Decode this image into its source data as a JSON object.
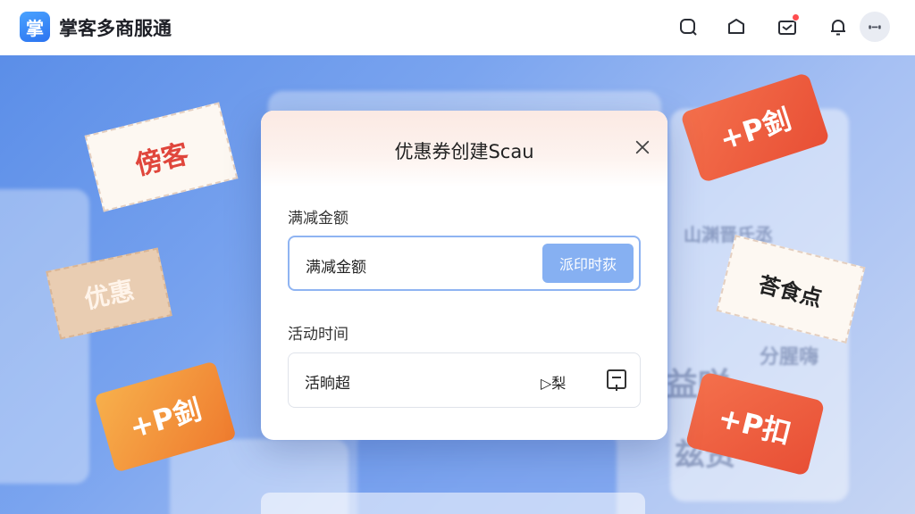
{
  "app": {
    "logo_char": "掌",
    "title": "掌客多商服通"
  },
  "topbar_icons": [
    "search-icon",
    "box-icon",
    "mail-icon",
    "bell-icon",
    "avatar-icon"
  ],
  "decorations": {
    "coupon_top_left": "傍客",
    "coupon_mid_left": "优惠",
    "coupon_bottom_left": "+P釗",
    "tag_top_right": "+P釗",
    "coupon_mid_right": "荅食点",
    "tag_bottom_right": "+P扣",
    "bg_text_1": "山渊晋氏丞",
    "bg_text_2": "分腥嗨",
    "bg_text_3": "益咲",
    "bg_text_4": "兹资"
  },
  "modal": {
    "title": "优惠券创建Scau",
    "amount": {
      "label": "满减金额",
      "value": "满减金额",
      "button_label": "派印时荻"
    },
    "time": {
      "label": "活动时间",
      "value": "活晌超",
      "suffix": "▷梨"
    }
  },
  "colors": {
    "accent": "#86b0f2",
    "brand": "#2b73f0",
    "coupon_red": "#e84f35",
    "coupon_orange": "#ef7b2e"
  }
}
